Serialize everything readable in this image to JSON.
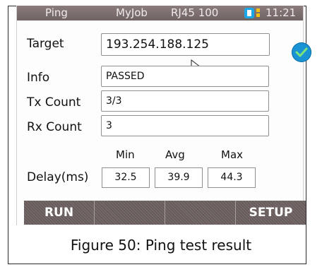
{
  "status_bar": {
    "tab1": "Ping",
    "tab2": "MyJob",
    "port": "RJ45 100",
    "time": "11:21",
    "battery_color": "#1aa7e8"
  },
  "fields": {
    "target_label": "Target",
    "target_value": "193.254.188.125",
    "info_label": "Info",
    "info_value": "PASSED",
    "tx_label": "Tx Count",
    "tx_value": "3/3",
    "rx_label": "Rx Count",
    "rx_value": "3"
  },
  "delay": {
    "label": "Delay(ms)",
    "min_header": "Min",
    "avg_header": "Avg",
    "max_header": "Max",
    "min": "32.5",
    "avg": "39.9",
    "max": "44.3"
  },
  "softkeys": [
    "RUN",
    "",
    "",
    "SETUP"
  ],
  "caption": "Figure 50: Ping test result"
}
